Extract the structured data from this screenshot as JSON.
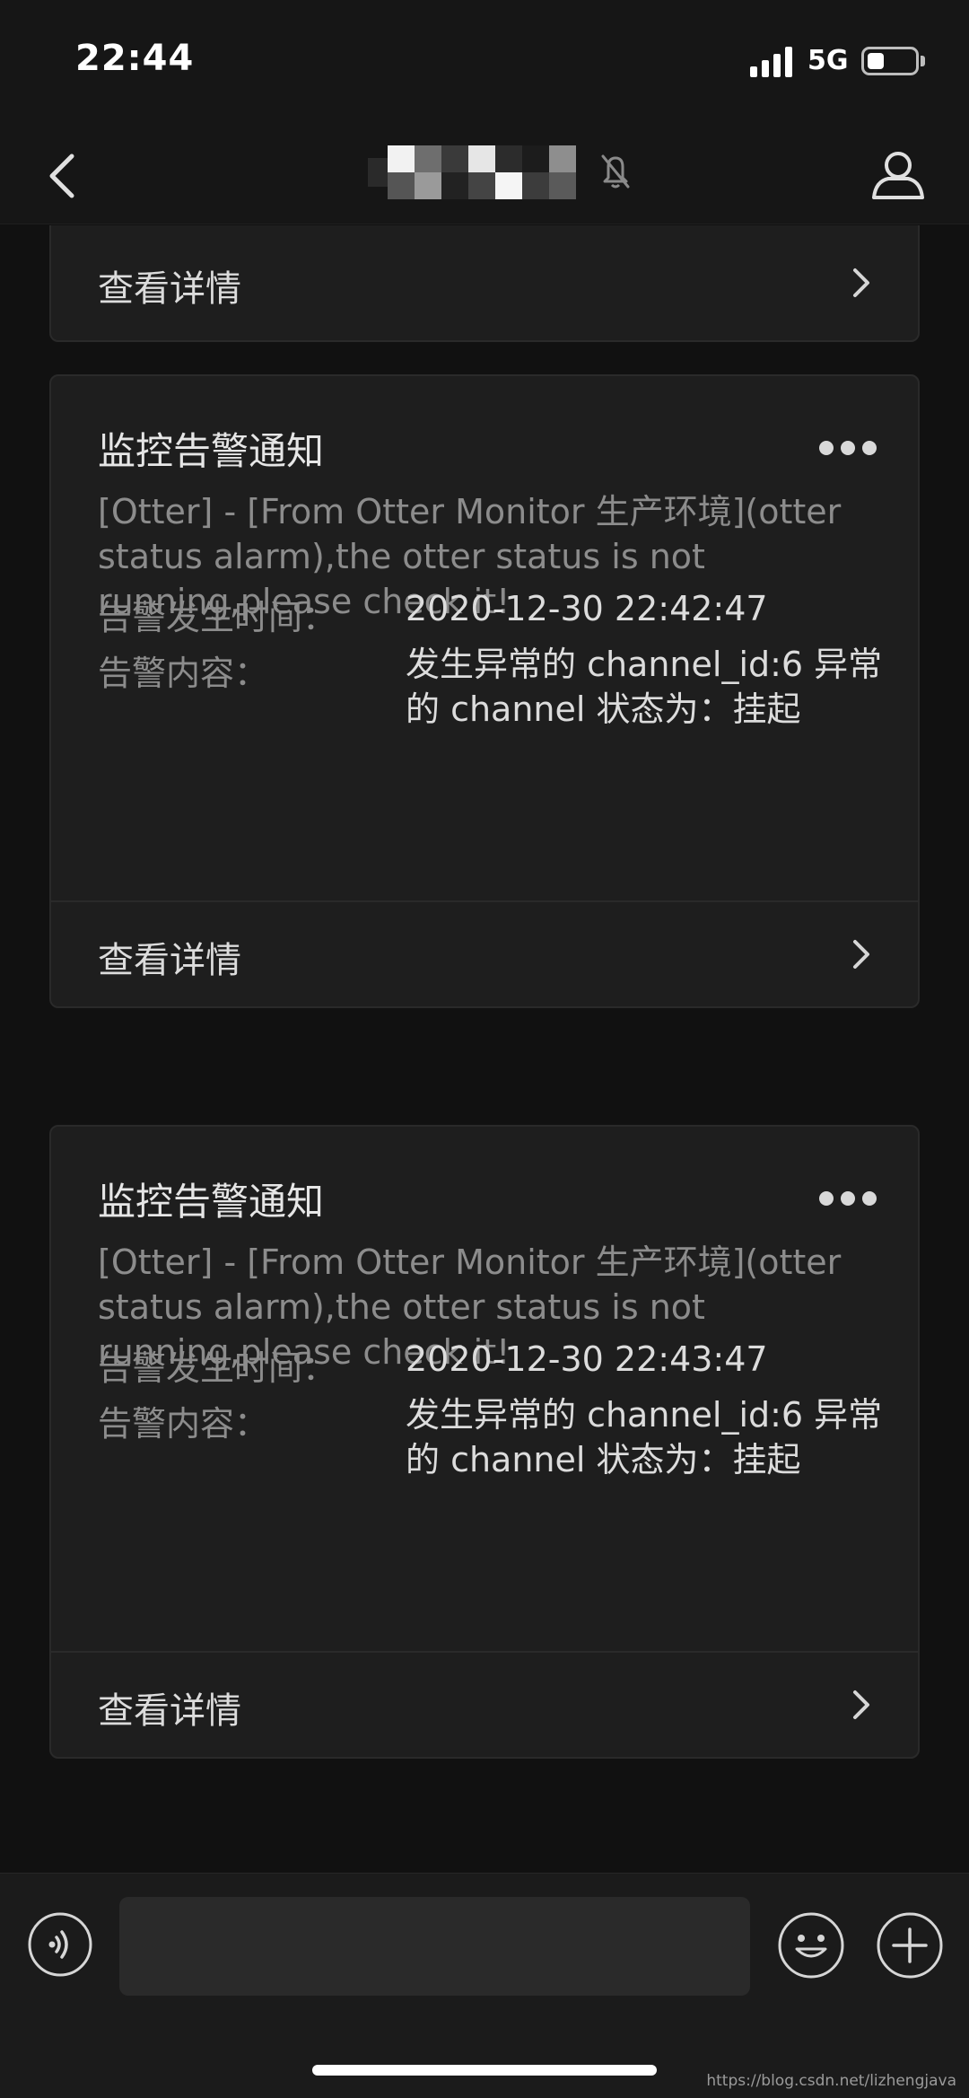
{
  "status_bar": {
    "time": "22:44",
    "network": "5G",
    "battery_level": 0.35
  },
  "nav": {
    "back_icon": "chevron-left-icon",
    "mute_icon": "bell-off-icon",
    "profile_icon": "person-icon"
  },
  "messages": {
    "top_card": {
      "footer_label": "查看详情"
    },
    "cards": [
      {
        "title": "监控告警通知",
        "description": "[Otter] - [From Otter Monitor 生产环境](otter status alarm),the otter status is not running,please check it!",
        "fields": [
          {
            "label": "告警发生时间：",
            "value": "2020-12-30 22:42:47"
          },
          {
            "label": "告警内容：",
            "value": "发生异常的 channel_id:6 异常的 channel 状态为：挂起"
          }
        ],
        "footer_label": "查看详情"
      },
      {
        "title": "监控告警通知",
        "description": "[Otter] - [From Otter Monitor 生产环境](otter status alarm),the otter status is not running,please check it!",
        "fields": [
          {
            "label": "告警发生时间：",
            "value": "2020-12-30 22:43:47"
          },
          {
            "label": "告警内容：",
            "value": "发生异常的 channel_id:6 异常的 channel 状态为：挂起"
          }
        ],
        "footer_label": "查看详情"
      }
    ]
  },
  "input_bar": {
    "placeholder": "",
    "voice_icon": "voice-icon",
    "emoji_icon": "emoji-icon",
    "plus_icon": "plus-icon"
  },
  "watermark": "https://blog.csdn.net/lizhengjava",
  "colors": {
    "background": "#111111",
    "card": "#1e1e1e",
    "text_primary": "#dcdcdc",
    "text_secondary": "#8c8c8c"
  }
}
